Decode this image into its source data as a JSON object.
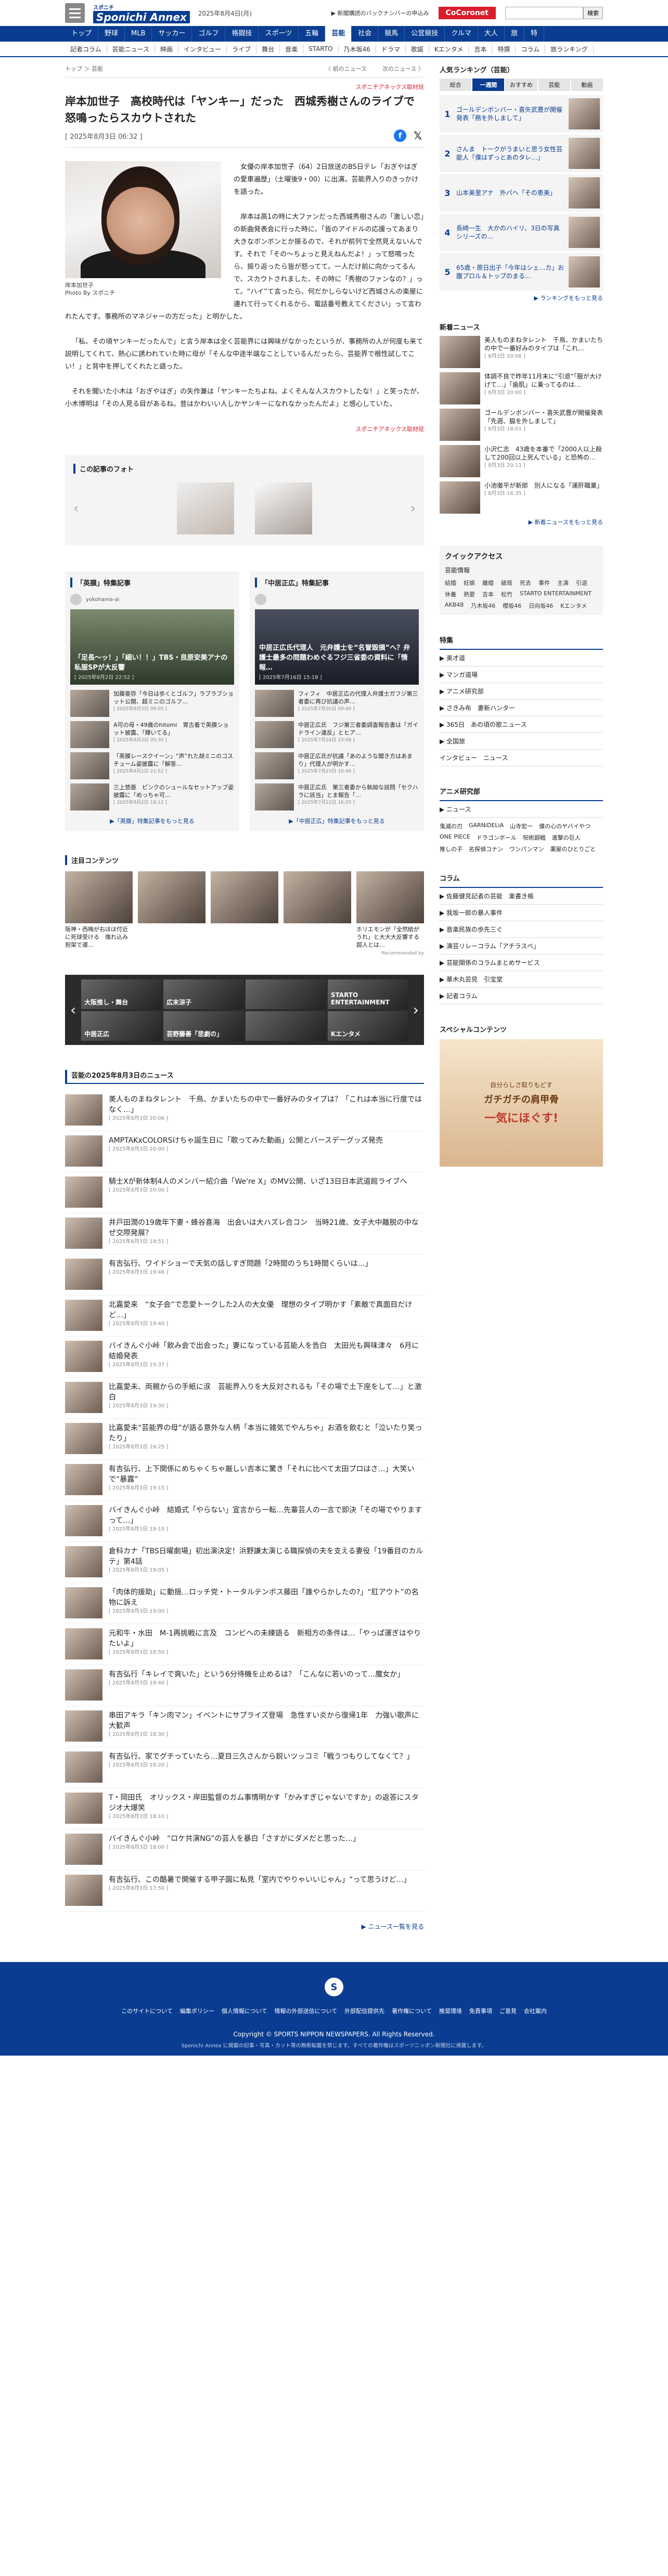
{
  "header": {
    "logo_small": "スポニチ",
    "logo_big": "Sponichi Annex",
    "date": "2025年8月4日(月)",
    "promo": "▶ 新聞購読のバックナンバーの申込み",
    "cocoro": "CoCoronet",
    "search_placeholder": "",
    "search_button": "検索"
  },
  "gnav": [
    "トップ",
    "野球",
    "MLB",
    "サッカー",
    "ゴルフ",
    "格闘技",
    "スポーツ",
    "五輪",
    "芸能",
    "社会",
    "競馬",
    "公営競技",
    "クルマ",
    "大人",
    "旅",
    "特"
  ],
  "gnav_active": "芸能",
  "subnav": [
    "記者コラム",
    "芸能ニュース",
    "映画",
    "インタビュー",
    "ライブ",
    "舞台",
    "音楽",
    "STARTO",
    "乃木坂46",
    "ドラマ",
    "歌謡",
    "Kエンタメ",
    "吉本",
    "特撰",
    "コラム",
    "旅ランキング"
  ],
  "crumb": {
    "items": "トップ ＞ 芸能",
    "prev": "〈 前のニュース",
    "next": "次のニュース 〉"
  },
  "article": {
    "credit": "スポニチアネックス取材班",
    "title": "岸本加世子　高校時代は「ヤンキー」だった　西城秀樹さんのライブで怒鳴ったらスカウトされた",
    "date": "[ 2025年8月3日 06:32 ]",
    "photo_caption": "岸本加世子",
    "photo_credit": "Photo By スポニチ",
    "p1": "女優の岸本加世子（64）2日放送のBS日テレ「おぎやはぎの愛車遍歴」（土曜後9・00）に出演。芸能界入りのきっかけを語った。",
    "p2": "岸本は高1の時に大ファンだった西城秀樹さんの「激しい恋」の新曲発表会に行った時に、「皆のアイドルの応援ってあまり大きなボンボンとか振るので、それが前列で全然見えないんです。それで「その～ちょっと見えねんだよ！」って怒鳴ったら、振り返ったら皆が怒ってて。一人だけ前に向かってるんで、スカウトされました、その時に「秀樹のファンなの？」って。“ハイ”て言ったら、何だかしらないけど西城さんの楽屋に連れて行ってくれるから、電話番号教えてください」って言われたんです。事務所のマネジャーの方だった」と明かした。",
    "p3": "「私、その頃ヤンキーだったんで」と言う岸本は全く芸能界には興味がなかったというが、事務所の人が何度も来て説明してくれて、熱心に誘われていた時に母が「そんな中途半端なことしているんだったら、芸能界で根性試してこい！」と背中を押してくれたと語った。",
    "p4": "それを聞いた小木は「おぎやはぎ」の矢作兼は「ヤンキーたちよね。よくそんな人スカウトしたな！」と笑ったが、小木博明は「その人見る目があるね。昔はかわいい人しかヤンキーになれなかったんだよ」と感心していた。",
    "credit_bottom": "スポニチアネックス取材班"
  },
  "photos": {
    "title": "この記事のフォト"
  },
  "features": [
    {
      "title": "「英膜」特集記事",
      "source": "yokohama-ai",
      "hero_title": "「足長～ッ！」「細い！！」TBS・良原安美アナの私服SPが大反響",
      "hero_date": "[ 2025年8月2日 22:52 ]",
      "items": [
        {
          "text": "加藤亜弥「今日は歩くとゴルフ」ラブラブショット公開、超ミニのゴルフ…",
          "date": "[ 2025年8月3日 09:05 ]"
        },
        {
          "text": "A可の母・49歳のhitomi　胃古着で英膜ショット披露、「輝いてる」",
          "date": "[ 2025年8月3日 05:30 ]"
        },
        {
          "text": "「英膜レースクイーン」“声”れた胡ミニのコスチューム姿披露に「解答…",
          "date": "[ 2025年8月2日 21:52 ]"
        },
        {
          "text": "三上悠亜　ピンクのシュールなセットアップ姿披露に「めっちゃ可…",
          "date": "[ 2025年8月2日 18:12 ]"
        }
      ],
      "more": "▶「英膜」特集記事をもっと見る"
    },
    {
      "title": "「中居正広」特集記事",
      "source": "",
      "hero_title": "中居正広氏代理人　元弁護士を“名誉毀損”へ？弁護士最多の問題わめぐるフジ三省委の資料に「情報…",
      "hero_date": "[ 2025年7月16日 15:18 ]",
      "items": [
        {
          "text": "フィフィ　中居正広の代理人弁護士ガフジ第三者委に再び抗議の声…",
          "date": "[ 2025年7月30日 09:40 ]"
        },
        {
          "text": "中居正広氏　フジ第三者委調査報告書は「ガイドライン違反」とヒア…",
          "date": "[ 2025年7月24日 15:08 ]"
        },
        {
          "text": "中居正広氏が抗議「あのような聞き方はあまり」代理人が明かす…",
          "date": "[ 2025年7月23日 10:46 ]"
        },
        {
          "text": "中居正広氏　第三者委から執拗な説問「セクハラに該当」とま報告「…",
          "date": "[ 2025年7月22日 16:25 ]"
        }
      ],
      "more": "▶「中居正広」特集記事をもっと見る"
    }
  ],
  "attention": {
    "title": "注目コンテンツ",
    "items": [
      {
        "text": "阪神・西梅が右ほほ付近に死球受ける　傷れ込み担架で運…"
      },
      {
        "text": ""
      },
      {
        "text": ""
      },
      {
        "text": ""
      },
      {
        "text": "ホリエモンが「全然給がうれ」と大大大反響する超人とは…"
      }
    ],
    "recommend": "Recommended by"
  },
  "carousel": [
    "大阪推し・舞台",
    "広末涼子",
    "",
    "STARTO ENTERTAINMENT",
    "中居正広",
    "芸野藤善「悲劇の」",
    "",
    "Kエンタメ"
  ],
  "newslist": {
    "title": "芸能の2025年8月3日のニュース",
    "items": [
      {
        "t": "美人ものまねタレント　千鳥、かまいたちの中で一番好みのタイプは？「これは本当に行度ではなく…」",
        "d": "[ 2025年8月3日 20:06 ]"
      },
      {
        "t": "AMPTAKxCOLORSけちゃ誕生日に「歌ってみた動画」公開とバースデーグッズ発売",
        "d": "[ 2025年8月3日 20:00 ]"
      },
      {
        "t": "騎士Xが新体制4人のメンバー紹介曲「We're X」のMV公開、いざ13日日本武道館ライブへ",
        "d": "[ 2025年8月3日 20:00 ]"
      },
      {
        "t": "井戸田潤の19歳年下妻・蜂谷喜海　出会いは大ハズレ合コン　当時21歳、女子大中離脱の中なぜ交際発展？",
        "d": "[ 2025年8月3日 19:51 ]"
      },
      {
        "t": "有吉弘行、ワイドショーで天気の話しすぎ問題「2時間のうち1時間くらいは…」",
        "d": "[ 2025年8月3日 19:46 ]"
      },
      {
        "t": "北嘉愛来　“女子会”で恋愛トークした2人の大女優　理想のタイプ明かす「素敵で真面目だけど…」",
        "d": "[ 2025年8月3日 19:40 ]"
      },
      {
        "t": "バイきんぐ小峠「飲み会で出会った」妻になっている芸能人を告白　太田光も興味津々　6月に結婚発表",
        "d": "[ 2025年8月3日 19:37 ]"
      },
      {
        "t": "比嘉愛未、両親からの手紙に涙　芸能界入りを大反対されるも「その場で土下座をして…」と激白",
        "d": "[ 2025年8月3日 19:30 ]"
      },
      {
        "t": "比嘉愛未“芸能界の母”が語る意外な人柄「本当に雑気でやんちゃ」お酒を飲むと「泣いたり笑ったり」",
        "d": "[ 2025年8月3日 19:25 ]"
      },
      {
        "t": "有吉弘行、上下関係にめちゃくちゃ厳しい吉本に驚き「それに比べて太田プロはさ…」大笑いで“暴露”",
        "d": "[ 2025年8月3日 19:15 ]"
      },
      {
        "t": "バイきんぐ小峠　結婚式「やらない」宣言から一転…先輩芸人の一言で即決「その場でやりますって…」",
        "d": "[ 2025年8月3日 19:10 ]"
      },
      {
        "t": "倉科カナ「TBS日曜劇場」初出演決定！浜野謙太演じる職探偵の夫を支える妻役「19番目のカルテ」第4話",
        "d": "[ 2025年8月3日 19:05 ]"
      },
      {
        "t": "「肉体的援助」に動揺…ロッチ党・トータルテンボス藤田「誰やらかしたの?」“肛アウト”の名物に訴え",
        "d": "[ 2025年8月3日 19:00 ]"
      },
      {
        "t": "元和牛・水田　M-1再挑戦に言及　コンビへの未練語る　新相方の条件は…「やっぱ運ぎはやりたいよ」",
        "d": "[ 2025年8月3日 18:50 ]"
      },
      {
        "t": "有吉弘行「キレイで爽いた」という6分待機を止めるは？「こんなに若いのって…魔女か」",
        "d": "[ 2025年8月3日 18:40 ]"
      },
      {
        "t": "串田アキラ「キン肉マン」イベントにサプライズ登場　急性すい炎から復帰1年　力強い歌声に大歓声",
        "d": "[ 2025年8月3日 18:30 ]"
      },
      {
        "t": "有吉弘行、家でグチっていたら…夏目三久さんから鋭いツッコミ「戦うつもりしてなくて？」",
        "d": "[ 2025年8月3日 18:20 ]"
      },
      {
        "t": "T・岡田氏　オリックス・岸田監督のガム事情明かす「かみすぎじゃないですか」の返答にスタジオ大爆笑",
        "d": "[ 2025年8月3日 18:10 ]"
      },
      {
        "t": "バイきんぐ小峠　“ロケ共演NG”の芸人を暴白「さすがにダメだと思った…」",
        "d": "[ 2025年8月3日 18:00 ]"
      },
      {
        "t": "有吉弘行、この酷暑で開催する甲子園に私見「室内でやりゃいいじゃん」“って思うけど…」",
        "d": "[ 2025年8月3日 17:50 ]"
      }
    ],
    "more": "▶ ニュース一覧を見る"
  },
  "side": {
    "rank_title": "人気ランキング（芸能）",
    "rank_tabs": [
      "総合",
      "一週間",
      "おすすめ",
      "芸能",
      "動画"
    ],
    "rank": [
      {
        "no": "1",
        "t": "ゴールデンボンバー・喜矢武豊が開催発表「務を外しまして」"
      },
      {
        "no": "2",
        "t": "さんま　トークがうまいと思う女性芸能人「僕はずっとあのタレ…」"
      },
      {
        "no": "3",
        "t": "山本美里アナ　外パへ「その恵美」"
      },
      {
        "no": "4",
        "t": "長崎一生　大かのハイリ、3日の写真シリーズの…"
      },
      {
        "no": "5",
        "t": "65歳・原日出子「今年はシェ…カ」お腹プロル＆トップのまる…"
      }
    ],
    "rank_more": "▶ ランキングをもっと見る",
    "news_title": "新着ニュース",
    "news": [
      {
        "t": "美人ものまねタレント　千鳥、かまいたちの中で一番好みのタイプは「これ…",
        "d": "[ 8月3日 20:06 ]"
      },
      {
        "t": "体調不良で昨年11月末に“引退”「服が大けげて…」「歯肌」に乗ってるのは…",
        "d": "[ 8月3日 20:00 ]"
      },
      {
        "t": "ゴールデンボンバー・喜矢武豊が開催発表「先週、脇を外しまして」",
        "d": "[ 8月3日 18:01 ]"
      },
      {
        "t": "小沢仁志　43歳を本番で「2000人以上殺して200回以上死んでいる」と恐怖の…",
        "d": "[ 8月3日 20:11 ]"
      },
      {
        "t": "小池徹平が新郎　別人になる「運肝職業」",
        "d": "[ 8月3日 16:35 ]"
      }
    ],
    "news_more": "▶ 新着ニュースをもっと見る",
    "qa_title": "クイックアクセス",
    "qa_sub": "芸能情報",
    "qa_links": [
      "結婚",
      "妊娠",
      "離婚",
      "破局",
      "死去",
      "事件",
      "主演",
      "引退",
      "休養",
      "熱愛",
      "吉本",
      "松竹",
      "STARTO ENTERTAINMENT",
      "AKB48",
      "乃木坂46",
      "櫻坂46",
      "日向坂46",
      "Kエンタメ"
    ],
    "special_title": "特集",
    "specials": [
      "▶ 美才道",
      "▶ マンガ道場",
      "▶ アニメ研究部",
      "▶ さきみ布　妻新ハンター",
      "▶ 365日　あの頃の歌ニュース",
      "▶ 全国旅",
      "インタビュー　ニュース"
    ],
    "anime_title": "アニメ研究部",
    "anime_sub": "▶ ニュース",
    "anime": [
      "鬼滅の刃",
      "GARNiDELiA",
      "山寺宏一",
      "僕の心のヤバイやつ",
      "ONE PIECE",
      "ドラゴンボール",
      "呪術廻戦",
      "進撃の巨人",
      "推しの子",
      "名探偵コナン",
      "ワンパンマン",
      "薬屋のひとりごと"
    ],
    "column_title": "コラム",
    "columns": [
      "▶ 佐藤健見記者の芸能　楽書き帳",
      "▶ 我坂一郎の暴人事件",
      "▶ 音楽民族の歩先三ぐ",
      "▶ 演芸リレーコラム「アチラスべ」",
      "▶ 芸能関係のコラムまとめサービス",
      "▶ 華木丸芸見　引宝堂",
      "▶ 記者コラム"
    ],
    "special_content": "スペシャルコンテンツ",
    "ad1": "自分らしさ取りもどす",
    "ad2": "ガチガチの肩甲骨",
    "ad3": "一気にほぐす!"
  },
  "footer": {
    "logo": "S",
    "links": [
      "このサイトについて",
      "編集ポリシー",
      "個人情報について",
      "情報の外部送信について",
      "外部配信提供先",
      "著作権について",
      "推奨環境",
      "免責事項",
      "ご意見",
      "会社案内"
    ],
    "copy": "Copyright © SPORTS NIPPON NEWSPAPERS. All Rights Reserved.",
    "note": "Sponichi Annex に掲載の記事・写真・カット等の無断転載を禁じます。すべての著作権はスポーツニッポン新聞社に帰属します。"
  }
}
